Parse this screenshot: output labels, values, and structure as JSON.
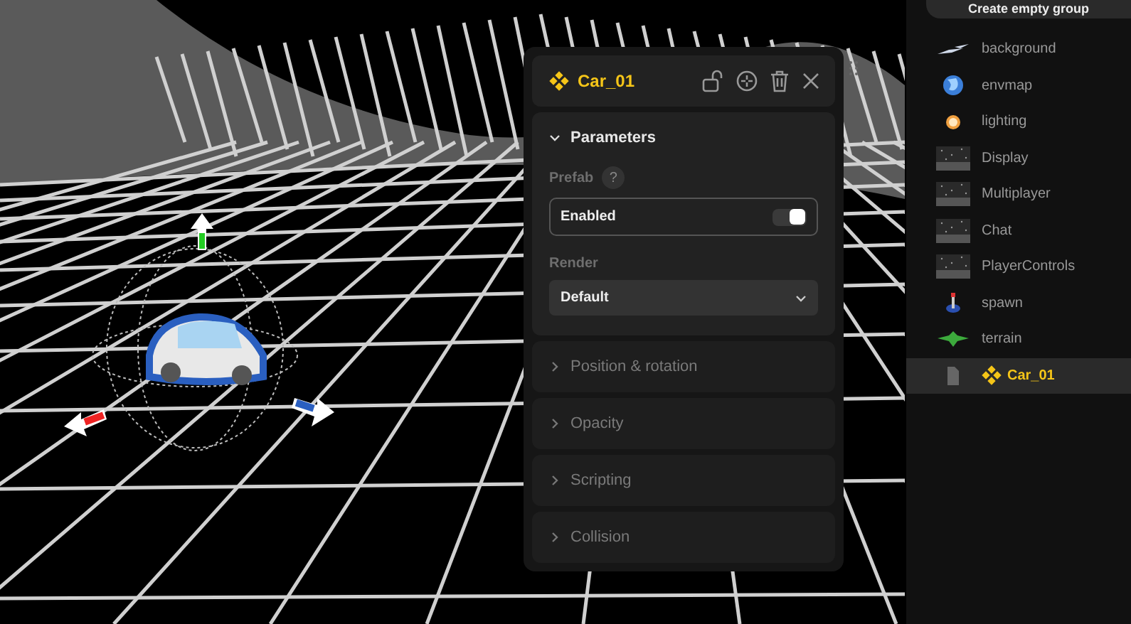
{
  "inspector": {
    "title": "Car_01",
    "prefab": true,
    "sections": [
      {
        "title": "Parameters",
        "expanded": true,
        "fields": [
          {
            "kind": "toggle",
            "label": "Prefab",
            "help": "?",
            "value": "Enabled",
            "on": true
          },
          {
            "kind": "select",
            "label": "Render",
            "value": "Default"
          }
        ]
      },
      {
        "title": "Position & rotation",
        "expanded": false
      },
      {
        "title": "Opacity",
        "expanded": false
      },
      {
        "title": "Scripting",
        "expanded": false
      },
      {
        "title": "Collision",
        "expanded": false
      }
    ]
  },
  "scene_tree": {
    "create_button": "Create empty group",
    "items": [
      {
        "label": "background",
        "kind": "planes",
        "prefab": false,
        "selected": false
      },
      {
        "label": "envmap",
        "kind": "globe",
        "prefab": false,
        "selected": false
      },
      {
        "label": "lighting",
        "kind": "light",
        "prefab": false,
        "selected": false
      },
      {
        "label": "Display",
        "kind": "thumbnail",
        "prefab": false,
        "selected": false
      },
      {
        "label": "Multiplayer",
        "kind": "thumbnail",
        "prefab": false,
        "selected": false
      },
      {
        "label": "Chat",
        "kind": "thumbnail",
        "prefab": false,
        "selected": false
      },
      {
        "label": "PlayerControls",
        "kind": "thumbnail",
        "prefab": false,
        "selected": false
      },
      {
        "label": "spawn",
        "kind": "spawn",
        "prefab": false,
        "selected": false
      },
      {
        "label": "terrain",
        "kind": "terrain",
        "prefab": false,
        "selected": false
      },
      {
        "label": "Car_01",
        "kind": "file",
        "prefab": true,
        "selected": true
      }
    ]
  }
}
